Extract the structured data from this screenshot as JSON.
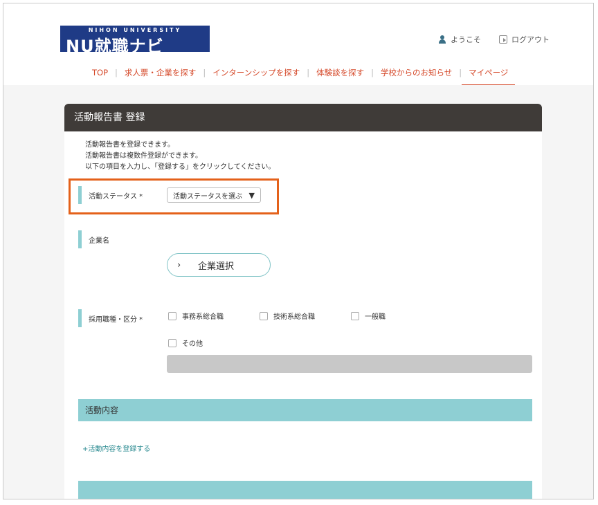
{
  "header": {
    "logo_top": "NIHON UNIVERSITY",
    "logo_main": "NU就職ナビ",
    "welcome": "ようこそ",
    "logout": "ログアウト"
  },
  "nav": {
    "items": [
      "TOP",
      "求人票・企業を探す",
      "インターンシップを探す",
      "体験談を探す",
      "学校からのお知らせ",
      "マイページ"
    ],
    "active": "マイページ"
  },
  "form": {
    "title": "活動報告書 登録",
    "intro": [
      "活動報告書を登録できます。",
      "活動報告書は複数件登録ができます。",
      "以下の項目を入力し、「登録する」をクリックしてください。"
    ],
    "status_label": "活動ステータス *",
    "status_select": "活動ステータスを選ぶ",
    "company_label": "企業名",
    "company_button": "企業選択",
    "job_label": "採用職種・区分 *",
    "job_options": [
      "事務系総合職",
      "技術系総合職",
      "一般職",
      "その他"
    ],
    "activity_header": "活動内容",
    "add_activity": "+活動内容を登録する"
  },
  "colors": {
    "accent": "#d5492a",
    "teal": "#8ecfd3",
    "dark": "#3f3b38",
    "highlight": "#e4611a",
    "logo_bg": "#1f3b86"
  }
}
